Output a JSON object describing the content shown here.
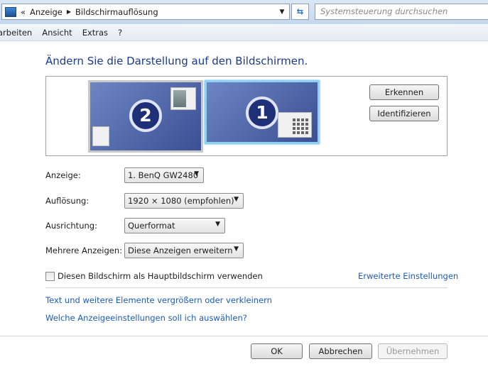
{
  "address": {
    "breadcrumb": [
      "Anzeige",
      "Bildschirmauflösung"
    ],
    "search_placeholder": "Systemsteuerung durchsuchen"
  },
  "menu": [
    "arbeiten",
    "Ansicht",
    "Extras",
    "?"
  ],
  "title": "Ändern Sie die Darstellung auf den Bildschirmen.",
  "monitors": [
    {
      "number": "2"
    },
    {
      "number": "1"
    }
  ],
  "buttons": {
    "detect": "Erkennen",
    "identify": "Identifizieren",
    "ok": "OK",
    "cancel": "Abbrechen",
    "apply": "Übernehmen"
  },
  "fields": {
    "display": {
      "label": "Anzeige:",
      "value": "1. BenQ GW2480"
    },
    "resolution": {
      "label": "Auflösung:",
      "value": "1920 × 1080 (empfohlen)"
    },
    "orientation": {
      "label": "Ausrichtung:",
      "value": "Querformat"
    },
    "multiple": {
      "label": "Mehrere Anzeigen:",
      "value": "Diese Anzeigen erweitern"
    }
  },
  "main_display_checkbox": "Diesen Bildschirm als Hauptbildschirm verwenden",
  "links": {
    "advanced": "Erweiterte Einstellungen",
    "text_size": "Text und weitere Elemente vergrößern oder verkleinern",
    "which_settings": "Welche Anzeigeeinstellungen soll ich auswählen?"
  }
}
